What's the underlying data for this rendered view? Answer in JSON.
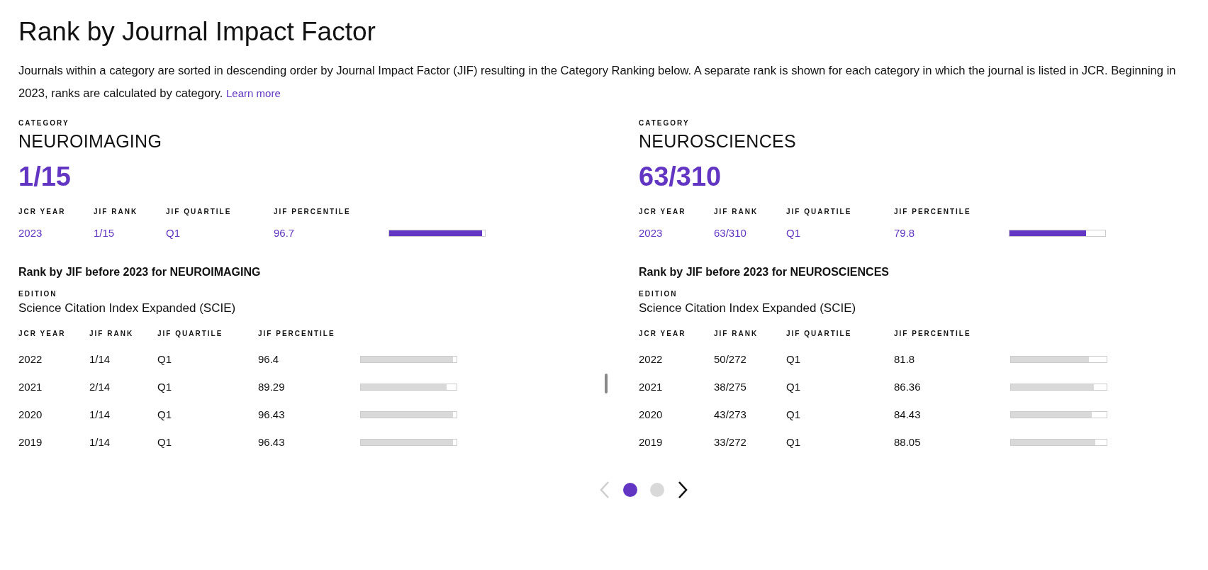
{
  "title": "Rank by Journal Impact Factor",
  "description": "Journals within a category are sorted in descending order by Journal Impact Factor (JIF) resulting in the Category Ranking below. A separate rank is shown for each category in which the journal is listed in JCR. Beginning in 2023, ranks are calculated by category.",
  "learn_more": "Learn more",
  "categories": [
    {
      "label": "CATEGORY",
      "name": "NEUROIMAGING",
      "rank": "1/15",
      "columns": [
        "JCR YEAR",
        "JIF RANK",
        "JIF QUARTILE",
        "JIF PERCENTILE"
      ],
      "current": {
        "year": "2023",
        "rank": "1/15",
        "quartile": "Q1",
        "percentile": "96.7",
        "level": 0.967
      },
      "history": {
        "title": "Rank by JIF before 2023 for NEUROIMAGING",
        "edition_label": "EDITION",
        "edition": "Science Citation Index Expanded (SCIE)",
        "columns": [
          "JCR YEAR",
          "JIF RANK",
          "JIF QUARTILE",
          "JIF PERCENTILE"
        ],
        "rows": [
          {
            "year": "2022",
            "rank": "1/14",
            "quartile": "Q1",
            "percentile": "96.4",
            "level": 0.964
          },
          {
            "year": "2021",
            "rank": "2/14",
            "quartile": "Q1",
            "percentile": "89.29",
            "level": 0.893
          },
          {
            "year": "2020",
            "rank": "1/14",
            "quartile": "Q1",
            "percentile": "96.43",
            "level": 0.964
          },
          {
            "year": "2019",
            "rank": "1/14",
            "quartile": "Q1",
            "percentile": "96.43",
            "level": 0.964
          }
        ]
      }
    },
    {
      "label": "CATEGORY",
      "name": "NEUROSCIENCES",
      "rank": "63/310",
      "columns": [
        "JCR YEAR",
        "JIF RANK",
        "JIF QUARTILE",
        "JIF PERCENTILE"
      ],
      "current": {
        "year": "2023",
        "rank": "63/310",
        "quartile": "Q1",
        "percentile": "79.8",
        "level": 0.798
      },
      "history": {
        "title": "Rank by JIF before 2023 for NEUROSCIENCES",
        "edition_label": "EDITION",
        "edition": "Science Citation Index Expanded (SCIE)",
        "columns": [
          "JCR YEAR",
          "JIF RANK",
          "JIF QUARTILE",
          "JIF PERCENTILE"
        ],
        "rows": [
          {
            "year": "2022",
            "rank": "50/272",
            "quartile": "Q1",
            "percentile": "81.8",
            "level": 0.818
          },
          {
            "year": "2021",
            "rank": "38/275",
            "quartile": "Q1",
            "percentile": "86.36",
            "level": 0.864
          },
          {
            "year": "2020",
            "rank": "43/273",
            "quartile": "Q1",
            "percentile": "84.43",
            "level": 0.844
          },
          {
            "year": "2019",
            "rank": "33/272",
            "quartile": "Q1",
            "percentile": "88.05",
            "level": 0.881
          }
        ]
      }
    }
  ],
  "pager": {
    "prev": {
      "disabled": true
    },
    "dots": [
      {
        "selected": true
      },
      {
        "selected": false
      }
    ],
    "next": {
      "disabled": false
    }
  }
}
